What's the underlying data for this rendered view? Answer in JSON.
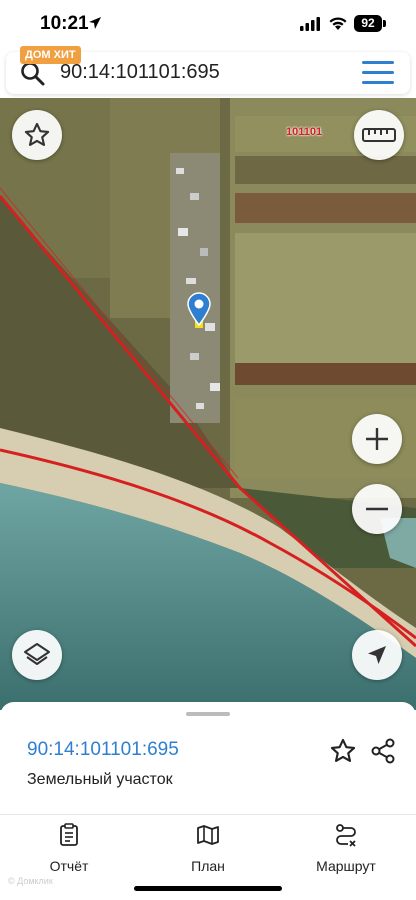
{
  "status": {
    "time": "10:21",
    "battery": "92"
  },
  "app": {
    "brand_badge": "ДОМ ХИТ"
  },
  "search": {
    "value": "90:14:101101:695",
    "placeholder": ""
  },
  "map": {
    "block_label": "101101"
  },
  "parcel": {
    "cadastral_number": "90:14:101101:695",
    "type": "Земельный участок"
  },
  "tabs": [
    {
      "label": "Отчёт",
      "icon": "report-icon"
    },
    {
      "label": "План",
      "icon": "map-plan-icon"
    },
    {
      "label": "Маршрут",
      "icon": "route-icon"
    }
  ],
  "watermark": "© Домклик",
  "colors": {
    "accent": "#2f7fd0",
    "boundary": "#d62020",
    "badge": "#f0a040"
  }
}
